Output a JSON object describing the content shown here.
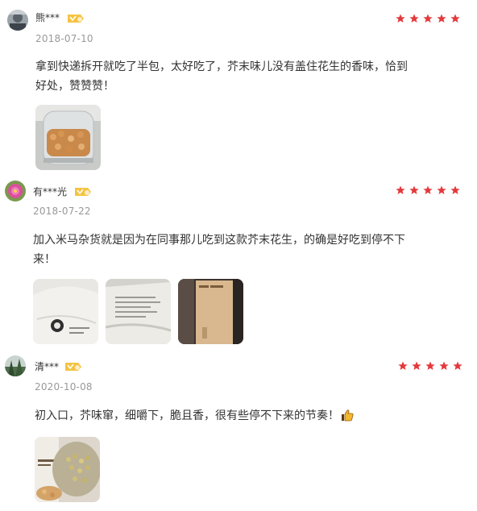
{
  "colors": {
    "star": "#E4393C",
    "badge": "#F5C342",
    "date": "#999999",
    "text": "#333333"
  },
  "reviews": [
    {
      "username": "熊***",
      "date": "2018-07-10",
      "rating": 5,
      "text_line1": "拿到快递拆开就吃了半包，太好吃了，芥末味儿没有盖住花生的香味，恰到",
      "text_line2": "好处，赞赞赞！",
      "photos": [
        "jar-of-peanuts"
      ]
    },
    {
      "username": "有***光",
      "date": "2018-07-22",
      "rating": 5,
      "text_line1": "加入米马杂货就是因为在同事那儿吃到这款芥末花生，的确是好吃到停不下",
      "text_line2": "来！",
      "photos": [
        "package-front",
        "package-back",
        "package-box"
      ]
    },
    {
      "username": "清***",
      "date": "2020-10-08",
      "rating": 5,
      "text_line1": "初入口，芥味窜，细嚼下，脆且香，很有些停不下来的节奏！",
      "emoji": "thumbs-up-icon",
      "photos": [
        "open-bag-peanuts"
      ]
    }
  ]
}
